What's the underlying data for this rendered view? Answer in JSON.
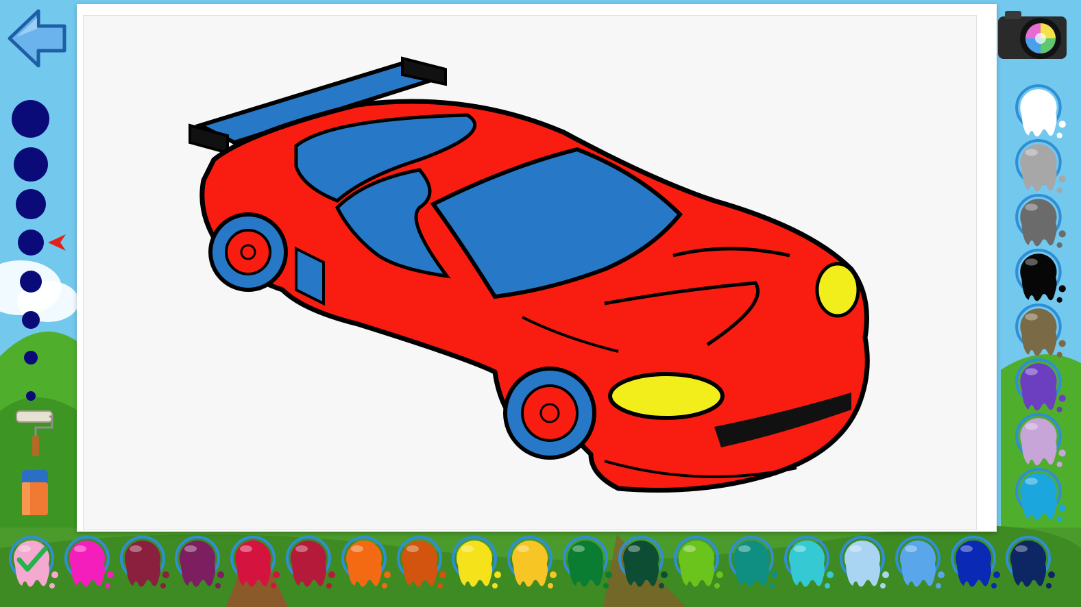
{
  "colors": {
    "brush": "#0a0a78",
    "selector": "#e3201b"
  },
  "tools": {
    "back": {
      "icon": "back-arrow-icon"
    },
    "camera": {
      "icon": "camera-icon"
    },
    "brush_sizes": {
      "count": 8,
      "selected_index": 3
    },
    "fill_tool": {
      "icon": "paint-roller-icon"
    },
    "eraser": {
      "icon": "eraser-icon"
    }
  },
  "right_palette": [
    {
      "name": "white",
      "color": "#ffffff"
    },
    {
      "name": "light-gray",
      "color": "#a7a7a7"
    },
    {
      "name": "dark-gray",
      "color": "#6b6b6b"
    },
    {
      "name": "black",
      "color": "#070707"
    },
    {
      "name": "brown",
      "color": "#7a6a45"
    },
    {
      "name": "purple",
      "color": "#6c3fc0"
    },
    {
      "name": "lavender",
      "color": "#c7a5d8"
    },
    {
      "name": "sky-blue",
      "color": "#1ba7de"
    }
  ],
  "bottom_palette": [
    {
      "name": "light-pink",
      "color": "#f5a9d0",
      "selected": true
    },
    {
      "name": "magenta",
      "color": "#f41ebd"
    },
    {
      "name": "maroon",
      "color": "#8a1f3e"
    },
    {
      "name": "plum",
      "color": "#7c1e60"
    },
    {
      "name": "crimson",
      "color": "#d4143f"
    },
    {
      "name": "dark-red",
      "color": "#b61a3a"
    },
    {
      "name": "orange",
      "color": "#f36a12"
    },
    {
      "name": "burnt-orange",
      "color": "#d2540f"
    },
    {
      "name": "yellow",
      "color": "#f6e21a"
    },
    {
      "name": "gold",
      "color": "#f7c524"
    },
    {
      "name": "green",
      "color": "#0a7d33"
    },
    {
      "name": "dark-green",
      "color": "#0d4d33"
    },
    {
      "name": "lime",
      "color": "#6bc41c"
    },
    {
      "name": "teal",
      "color": "#0f8f82"
    },
    {
      "name": "turquoise",
      "color": "#35c9d3"
    },
    {
      "name": "pale-blue",
      "color": "#a9d4f2"
    },
    {
      "name": "cornflower",
      "color": "#5aa6ea"
    },
    {
      "name": "royal-blue",
      "color": "#0a2ab5"
    },
    {
      "name": "navy",
      "color": "#0d2664"
    }
  ],
  "drawing": {
    "subject": "sports car",
    "body_color": "#f81d10",
    "glass_color": "#2878c8",
    "light_color": "#f2ee1c"
  }
}
